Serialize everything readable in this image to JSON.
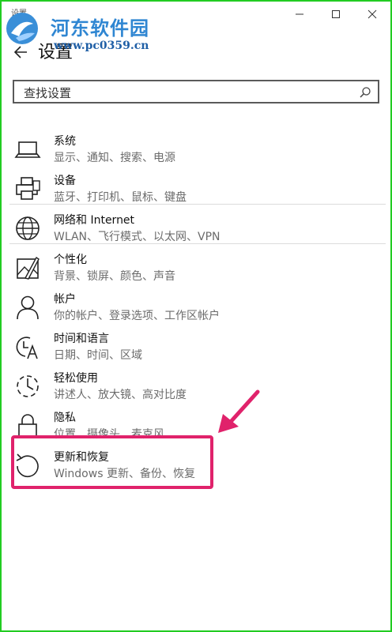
{
  "window": {
    "title": "设置",
    "controls": {
      "minimize": "minimize",
      "maximize": "maximize",
      "close": "close"
    }
  },
  "header": {
    "title": "设置"
  },
  "search": {
    "placeholder": "查找设置"
  },
  "watermark": {
    "name": "河东软件园",
    "url": "www.pc0359.cn"
  },
  "nav": {
    "items": [
      {
        "title": "系统",
        "subtitle": "显示、通知、搜索、电源",
        "icon": "laptop-icon"
      },
      {
        "title": "设备",
        "subtitle": "蓝牙、打印机、鼠标、键盘",
        "icon": "printer-icon"
      },
      {
        "title": "网络和 Internet",
        "subtitle": "WLAN、飞行模式、以太网、VPN",
        "icon": "globe-icon"
      },
      {
        "title": "个性化",
        "subtitle": "背景、锁屏、颜色、声音",
        "icon": "personalize-icon"
      },
      {
        "title": "帐户",
        "subtitle": "你的帐户、登录选项、工作区帐户",
        "icon": "user-icon"
      },
      {
        "title": "时间和语言",
        "subtitle": "日期、时间、区域",
        "icon": "time-language-icon"
      },
      {
        "title": "轻松使用",
        "subtitle": "讲述人、放大镜、高对比度",
        "icon": "ease-of-access-icon"
      },
      {
        "title": "隐私",
        "subtitle": "位置、摄像头、麦克风",
        "icon": "lock-icon"
      },
      {
        "title": "更新和恢复",
        "subtitle": "Windows 更新、备份、恢复",
        "icon": "update-icon"
      }
    ]
  },
  "colors": {
    "frame": "#22cc22",
    "highlight": "#e0226b",
    "watermark_blue": "#2f86d2"
  }
}
